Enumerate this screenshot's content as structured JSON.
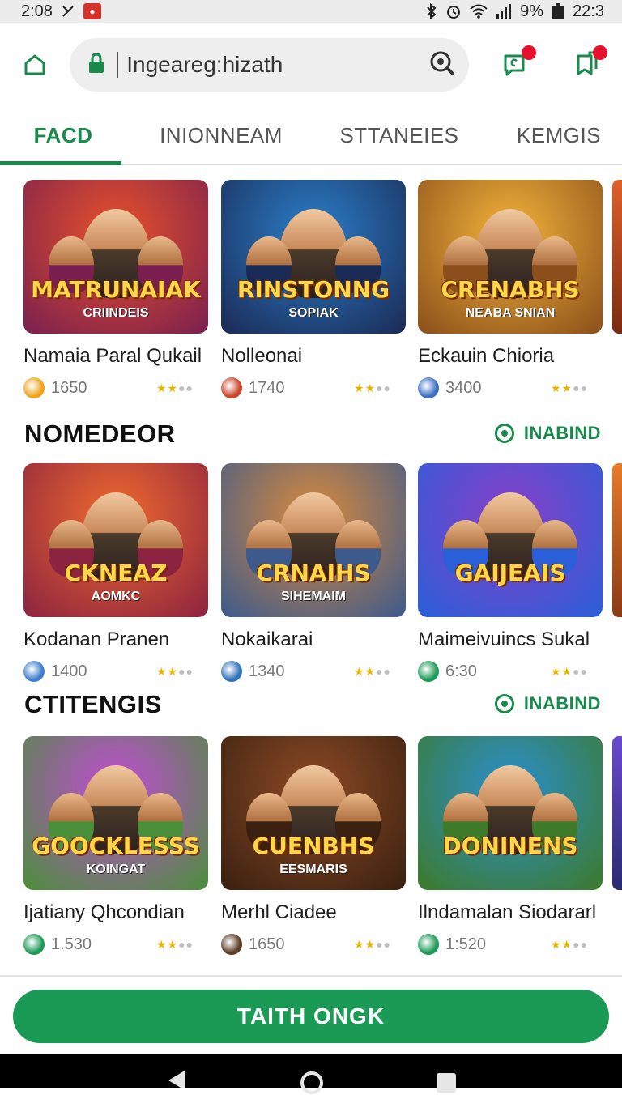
{
  "status": {
    "time": "2:08",
    "battery": "9%",
    "clock": "22:3",
    "app_badge": "●"
  },
  "topbar": {
    "url": "Ingeareg:hizath"
  },
  "tabs": [
    {
      "label": "FACD",
      "active": true
    },
    {
      "label": "INIONNEAM",
      "active": false
    },
    {
      "label": "STTANEIES",
      "active": false
    },
    {
      "label": "KEMGIS",
      "active": false
    }
  ],
  "rows": [
    {
      "cards": [
        {
          "title": "Namaia Paral Qukail",
          "count": "1650",
          "art_title": "MATRUNAIAK",
          "art_sub": "CRIINDEIS",
          "palette": [
            "#e8512a",
            "#7a1f4f"
          ],
          "meta_color": "#f0a31a"
        },
        {
          "title": "Nolleonai",
          "count": "1740",
          "art_title": "RINSTONNG",
          "art_sub": "SOPIAK",
          "palette": [
            "#2a7fc9",
            "#1b2a55"
          ],
          "meta_color": "#c9452a"
        },
        {
          "title": "Eckauin Chioria",
          "count": "3400",
          "art_title": "CRENABHS",
          "art_sub": "NEABA SNIAN",
          "palette": [
            "#f2b33a",
            "#8a4f1a"
          ],
          "meta_color": "#3b6fc4"
        }
      ]
    },
    {
      "section_title": "NOMEDEOR",
      "section_link": "INABIND",
      "cards": [
        {
          "title": "Kodanan Pranen",
          "count": "1400",
          "art_title": "CKNEAZ",
          "art_sub": "AOMKC",
          "palette": [
            "#f06a2e",
            "#8c2340"
          ],
          "meta_color": "#3c7fd0"
        },
        {
          "title": "Nokaikarai",
          "count": "1340",
          "art_title": "CRNAIHS",
          "art_sub": "SIHEMAIM",
          "palette": [
            "#d98a3c",
            "#3d5a8c"
          ],
          "meta_color": "#2f72b8"
        },
        {
          "title": "Maimeivuincs Sukal",
          "count": "6:30",
          "art_title": "GAIJEAIS",
          "art_sub": "",
          "palette": [
            "#8a3fc8",
            "#2a5fd8"
          ],
          "meta_color": "#1b9a55"
        }
      ]
    },
    {
      "section_title": "CTITENGIS",
      "section_link": "INABIND",
      "cards": [
        {
          "title": "Ijatiany Qhcondian",
          "count": "1.530",
          "art_title": "GOOCKLESSS",
          "art_sub": "KOINGAT",
          "palette": [
            "#c44ad8",
            "#4a8f3a"
          ],
          "meta_color": "#1b9a55"
        },
        {
          "title": "Merhl Ciadee",
          "count": "1650",
          "art_title": "CUENBHS",
          "art_sub": "EESMARIS",
          "palette": [
            "#8c4a25",
            "#3a2010"
          ],
          "meta_color": "#5a3a22"
        },
        {
          "title": "Ilndamalan Siodararl",
          "count": "1:520",
          "art_title": "DONINENS",
          "art_sub": "",
          "palette": [
            "#2a8fd0",
            "#3d7a2a"
          ],
          "meta_color": "#1b9a55"
        }
      ]
    }
  ],
  "cta": {
    "label": "TAITH ONGK"
  },
  "colors": {
    "accent": "#178a4c",
    "cta": "#1a9a55",
    "notification": "#e8112d"
  },
  "icons": [
    "home-icon",
    "lock-icon",
    "search-icon",
    "notification-icon",
    "bookmark-icon",
    "back-icon",
    "home-nav-icon",
    "recents-icon"
  ]
}
